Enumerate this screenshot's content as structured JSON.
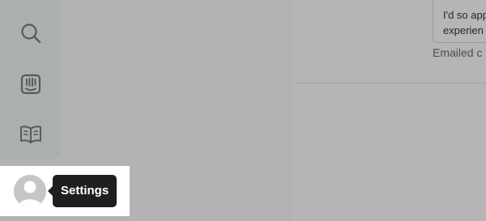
{
  "sidebar": {
    "items": [
      {
        "icon": "search-icon",
        "label": ""
      },
      {
        "icon": "intercom-inbox-icon",
        "label": ""
      },
      {
        "icon": "book-icon",
        "label": ""
      }
    ],
    "profile": {
      "icon": "avatar-icon"
    }
  },
  "tooltip": {
    "text": "Settings"
  },
  "conversation": {
    "message_lines": [
      "I'd so app",
      "experien"
    ],
    "status": "Emailed c"
  },
  "colors": {
    "overlay_gray": "#b3b3b3",
    "sidebar": "#a9b0ad",
    "tooltip_bg": "#1f1f22",
    "highlight": "#ffffff"
  }
}
